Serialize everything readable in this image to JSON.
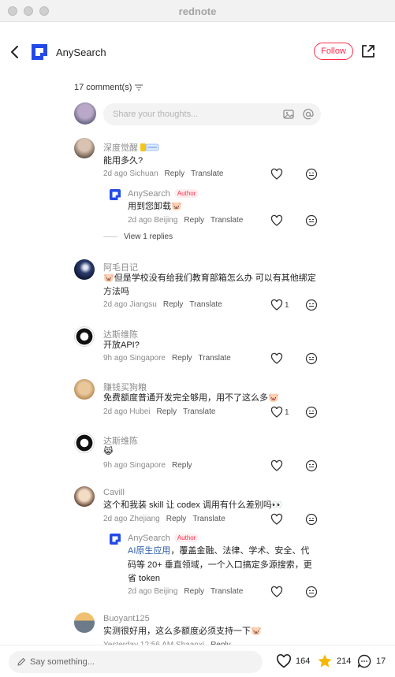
{
  "window": {
    "title": "rednote"
  },
  "header": {
    "brand": "AnySearch",
    "follow_label": "Follow"
  },
  "comments_count_label": "17 comment(s)",
  "composer": {
    "placeholder": "Share your thoughts..."
  },
  "comments": [
    {
      "user": "深度觉醒",
      "text": "能用多久?",
      "time": "2d ago",
      "location": "Sichuan",
      "reply": "Reply",
      "translate": "Translate"
    },
    {
      "user": "AnySearch",
      "badge": "Author",
      "text": "用到您卸载🐷",
      "time": "2d ago",
      "location": "Beijing",
      "reply": "Reply",
      "translate": "Translate",
      "view_replies": "View 1 replies"
    },
    {
      "user": "阿毛日记",
      "text_line1": "🐷但是学校没有给我们教育部箱怎么办 可以有其他绑定",
      "text_line2": "方法吗",
      "time": "2d ago",
      "location": "Jiangsu",
      "reply": "Reply",
      "translate": "Translate",
      "likes": "1"
    },
    {
      "user": "达斯维陈",
      "text": "开放API?",
      "time": "9h ago",
      "location": "Singapore",
      "reply": "Reply",
      "translate": "Translate"
    },
    {
      "user": "赚钱买狗粮",
      "text": "免费额度普通开发完全够用，用不了这么多🐷",
      "time": "2d ago",
      "location": "Hubei",
      "reply": "Reply",
      "translate": "Translate",
      "likes": "1"
    },
    {
      "user": "达斯维陈",
      "text": "😹",
      "time": "9h ago",
      "location": "Singapore",
      "reply": "Reply"
    },
    {
      "user": "Cavill",
      "text": "这个和我装 skill 让 codex 调用有什么差别吗👀",
      "time": "2d ago",
      "location": "Zhejiang",
      "reply": "Reply",
      "translate": "Translate"
    },
    {
      "user": "AnySearch",
      "badge": "Author",
      "link_text": "AI原生应用",
      "text_rest": "，覆盖金融、法律、学术、安全、代",
      "text_line2": "码等 20+ 垂直领域，一个入口搞定多源搜索，更",
      "text_line3": "省 token",
      "time": "2d ago",
      "location": "Beijing",
      "reply": "Reply",
      "translate": "Translate"
    },
    {
      "user": "Buoyant125",
      "text": "实测很好用，这么多额度必须支持一下🐷",
      "time": "Yesterday 12:56 AM",
      "location": "Shaanxi",
      "reply": "Reply"
    }
  ],
  "bottom_bar": {
    "say_placeholder": "Say something...",
    "likes": "164",
    "stars": "214",
    "comments": "17"
  },
  "colors": {
    "accent": "#ff2e4d",
    "star": "#f5b800",
    "link": "#2b5aa8",
    "brand_blue": "#2349e8"
  }
}
